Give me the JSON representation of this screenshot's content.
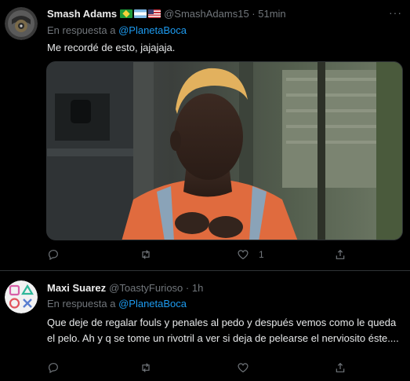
{
  "tweets": [
    {
      "name": "Smash Adams",
      "handle": "@SmashAdams15",
      "time": "51min",
      "reply_prefix": "En respuesta a",
      "reply_mention": "@PlanetaBoca",
      "text": "Me recordé de esto, jajajaja.",
      "flags": [
        "brazil-flag",
        "argentina-flag",
        "us-flag"
      ],
      "actions": {
        "reply_count": "",
        "retweet_count": "",
        "like_count": "1",
        "share_count": ""
      }
    },
    {
      "name": "Maxi Suarez",
      "handle": "@ToastyFurioso",
      "time": "1h",
      "reply_prefix": "En respuesta a",
      "reply_mention": "@PlanetaBoca",
      "text": "Que deje de regalar fouls y penales al pedo y después vemos como le queda el pelo. Ah y q se tome un rivotril a ver si deja de pelearse el nerviosito éste....",
      "actions": {
        "reply_count": "",
        "retweet_count": "",
        "like_count": "",
        "share_count": ""
      }
    }
  ],
  "separator": " · ",
  "more_glyph": "···",
  "colors": {
    "accent": "#1d9bf0",
    "muted": "#71767b",
    "background": "#000000",
    "border": "#2f3336"
  }
}
